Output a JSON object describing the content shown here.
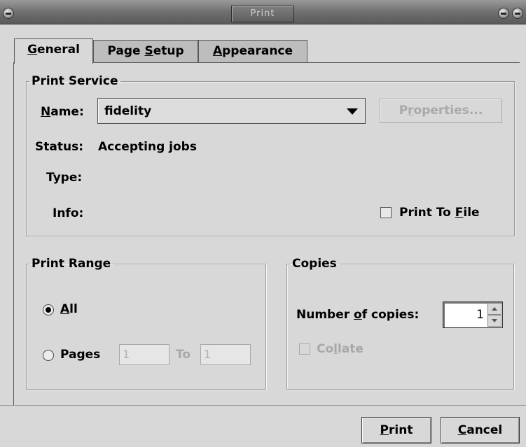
{
  "window": {
    "title": "Print"
  },
  "tabs": [
    {
      "label_pre": "",
      "label_key": "G",
      "label_post": "eneral",
      "active": true
    },
    {
      "label_pre": "Page ",
      "label_key": "S",
      "label_post": "etup",
      "active": false
    },
    {
      "label_pre": "",
      "label_key": "A",
      "label_post": "ppearance",
      "active": false
    }
  ],
  "print_service": {
    "legend": "Print Service",
    "name_label_key": "N",
    "name_label_rest": "ame:",
    "name_value": "fidelity",
    "properties_pre": "P",
    "properties_key": "r",
    "properties_post": "operties...",
    "status_label": "Status:",
    "status_value": "Accepting jobs",
    "type_label": "Type:",
    "info_label": "Info:",
    "print_to_file_pre": "Print To ",
    "print_to_file_key": "F",
    "print_to_file_post": "ile",
    "print_to_file_checked": false
  },
  "print_range": {
    "legend": "Print Range",
    "all_key": "A",
    "all_rest": "ll",
    "all_checked": true,
    "pages_pre": "Pa",
    "pages_key": "g",
    "pages_post": "es",
    "pages_from": "1",
    "to_label": "To",
    "pages_to": "1"
  },
  "copies": {
    "legend": "Copies",
    "number_pre": "Number ",
    "number_key": "o",
    "number_post": "f copies:",
    "count": "1",
    "collate_pre": "Co",
    "collate_key": "l",
    "collate_post": "late",
    "collate_checked": false
  },
  "buttons": {
    "print_key": "P",
    "print_rest": "rint",
    "cancel_key": "C",
    "cancel_rest": "ancel"
  }
}
